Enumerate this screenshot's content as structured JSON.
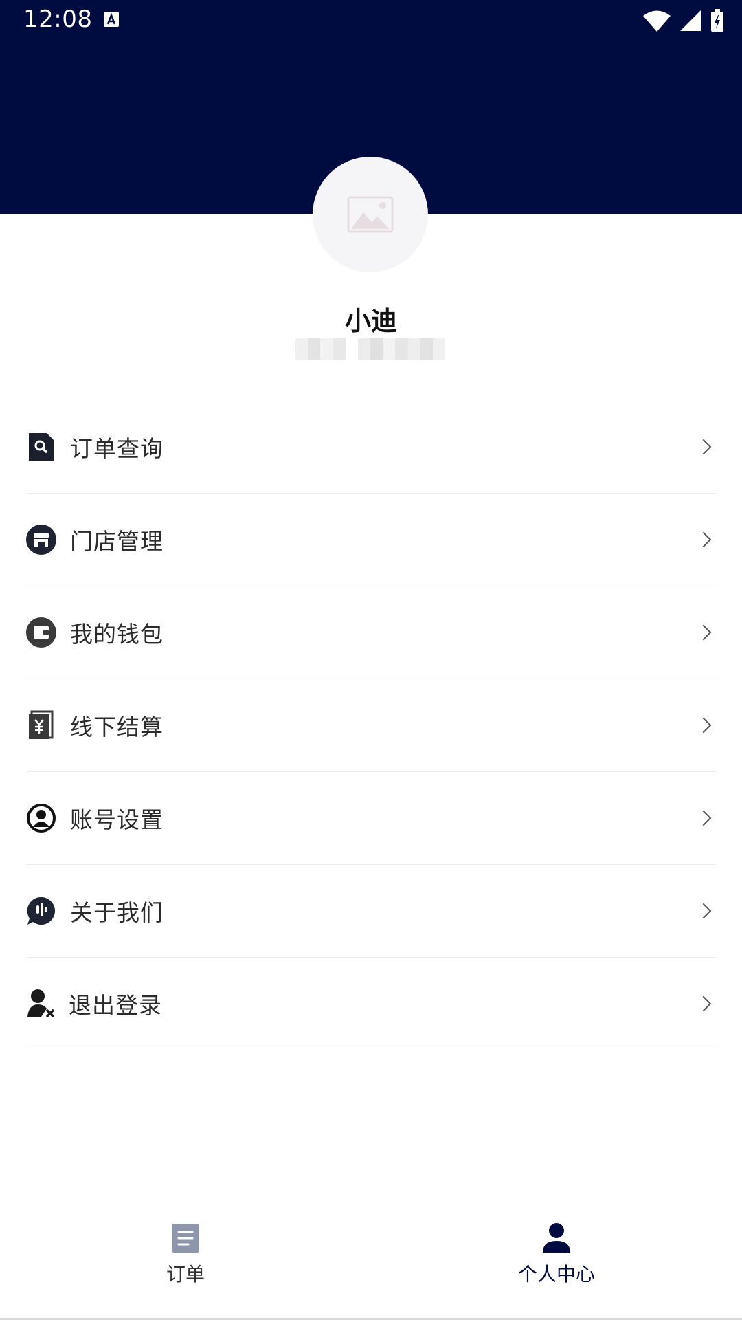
{
  "status_bar": {
    "time": "12:08"
  },
  "profile": {
    "name": "小迪"
  },
  "menu": {
    "items": [
      {
        "label": "订单查询",
        "icon": "order-search-icon"
      },
      {
        "label": "门店管理",
        "icon": "store-icon"
      },
      {
        "label": "我的钱包",
        "icon": "wallet-icon"
      },
      {
        "label": "线下结算",
        "icon": "offline-settlement-icon"
      },
      {
        "label": "账号设置",
        "icon": "account-settings-icon"
      },
      {
        "label": "关于我们",
        "icon": "about-us-icon"
      },
      {
        "label": "退出登录",
        "icon": "logout-icon"
      }
    ]
  },
  "tabbar": {
    "tabs": [
      {
        "label": "订单",
        "icon": "document-icon",
        "active": false
      },
      {
        "label": "个人中心",
        "icon": "person-icon",
        "active": true
      }
    ]
  },
  "colors": {
    "header_bg": "#000c3f",
    "active_tab": "#000c3f",
    "inactive_tab_icon": "#8e96ab"
  }
}
